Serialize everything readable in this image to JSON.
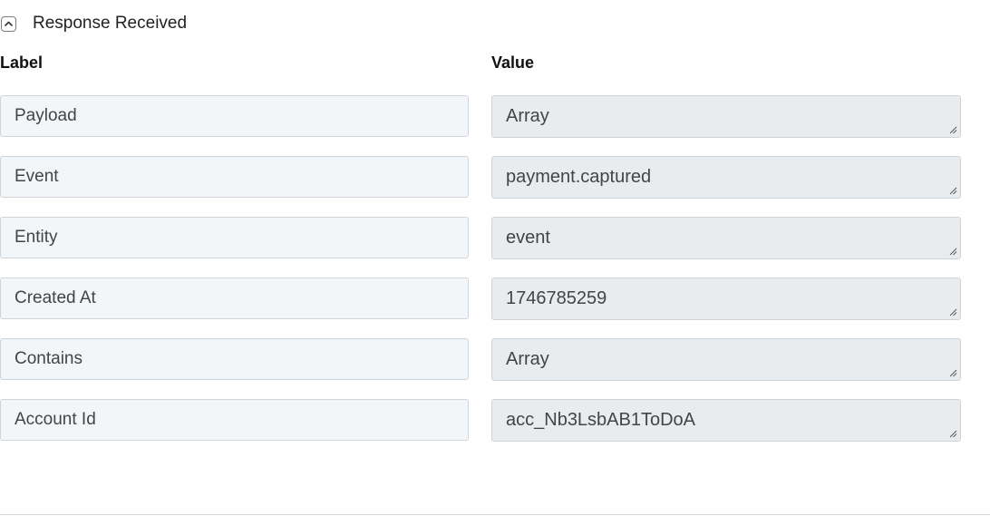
{
  "section": {
    "title": "Response Received",
    "toggle_icon": "chevron-up-icon"
  },
  "columns": {
    "label": "Label",
    "value": "Value"
  },
  "fields": [
    {
      "label": "Payload",
      "value": "Array"
    },
    {
      "label": "Event",
      "value": "payment.captured"
    },
    {
      "label": "Entity",
      "value": "event"
    },
    {
      "label": "Created At",
      "value": "1746785259"
    },
    {
      "label": "Contains",
      "value": "Array"
    },
    {
      "label": "Account Id",
      "value": "acc_Nb3LsbAB1ToDoA"
    }
  ]
}
